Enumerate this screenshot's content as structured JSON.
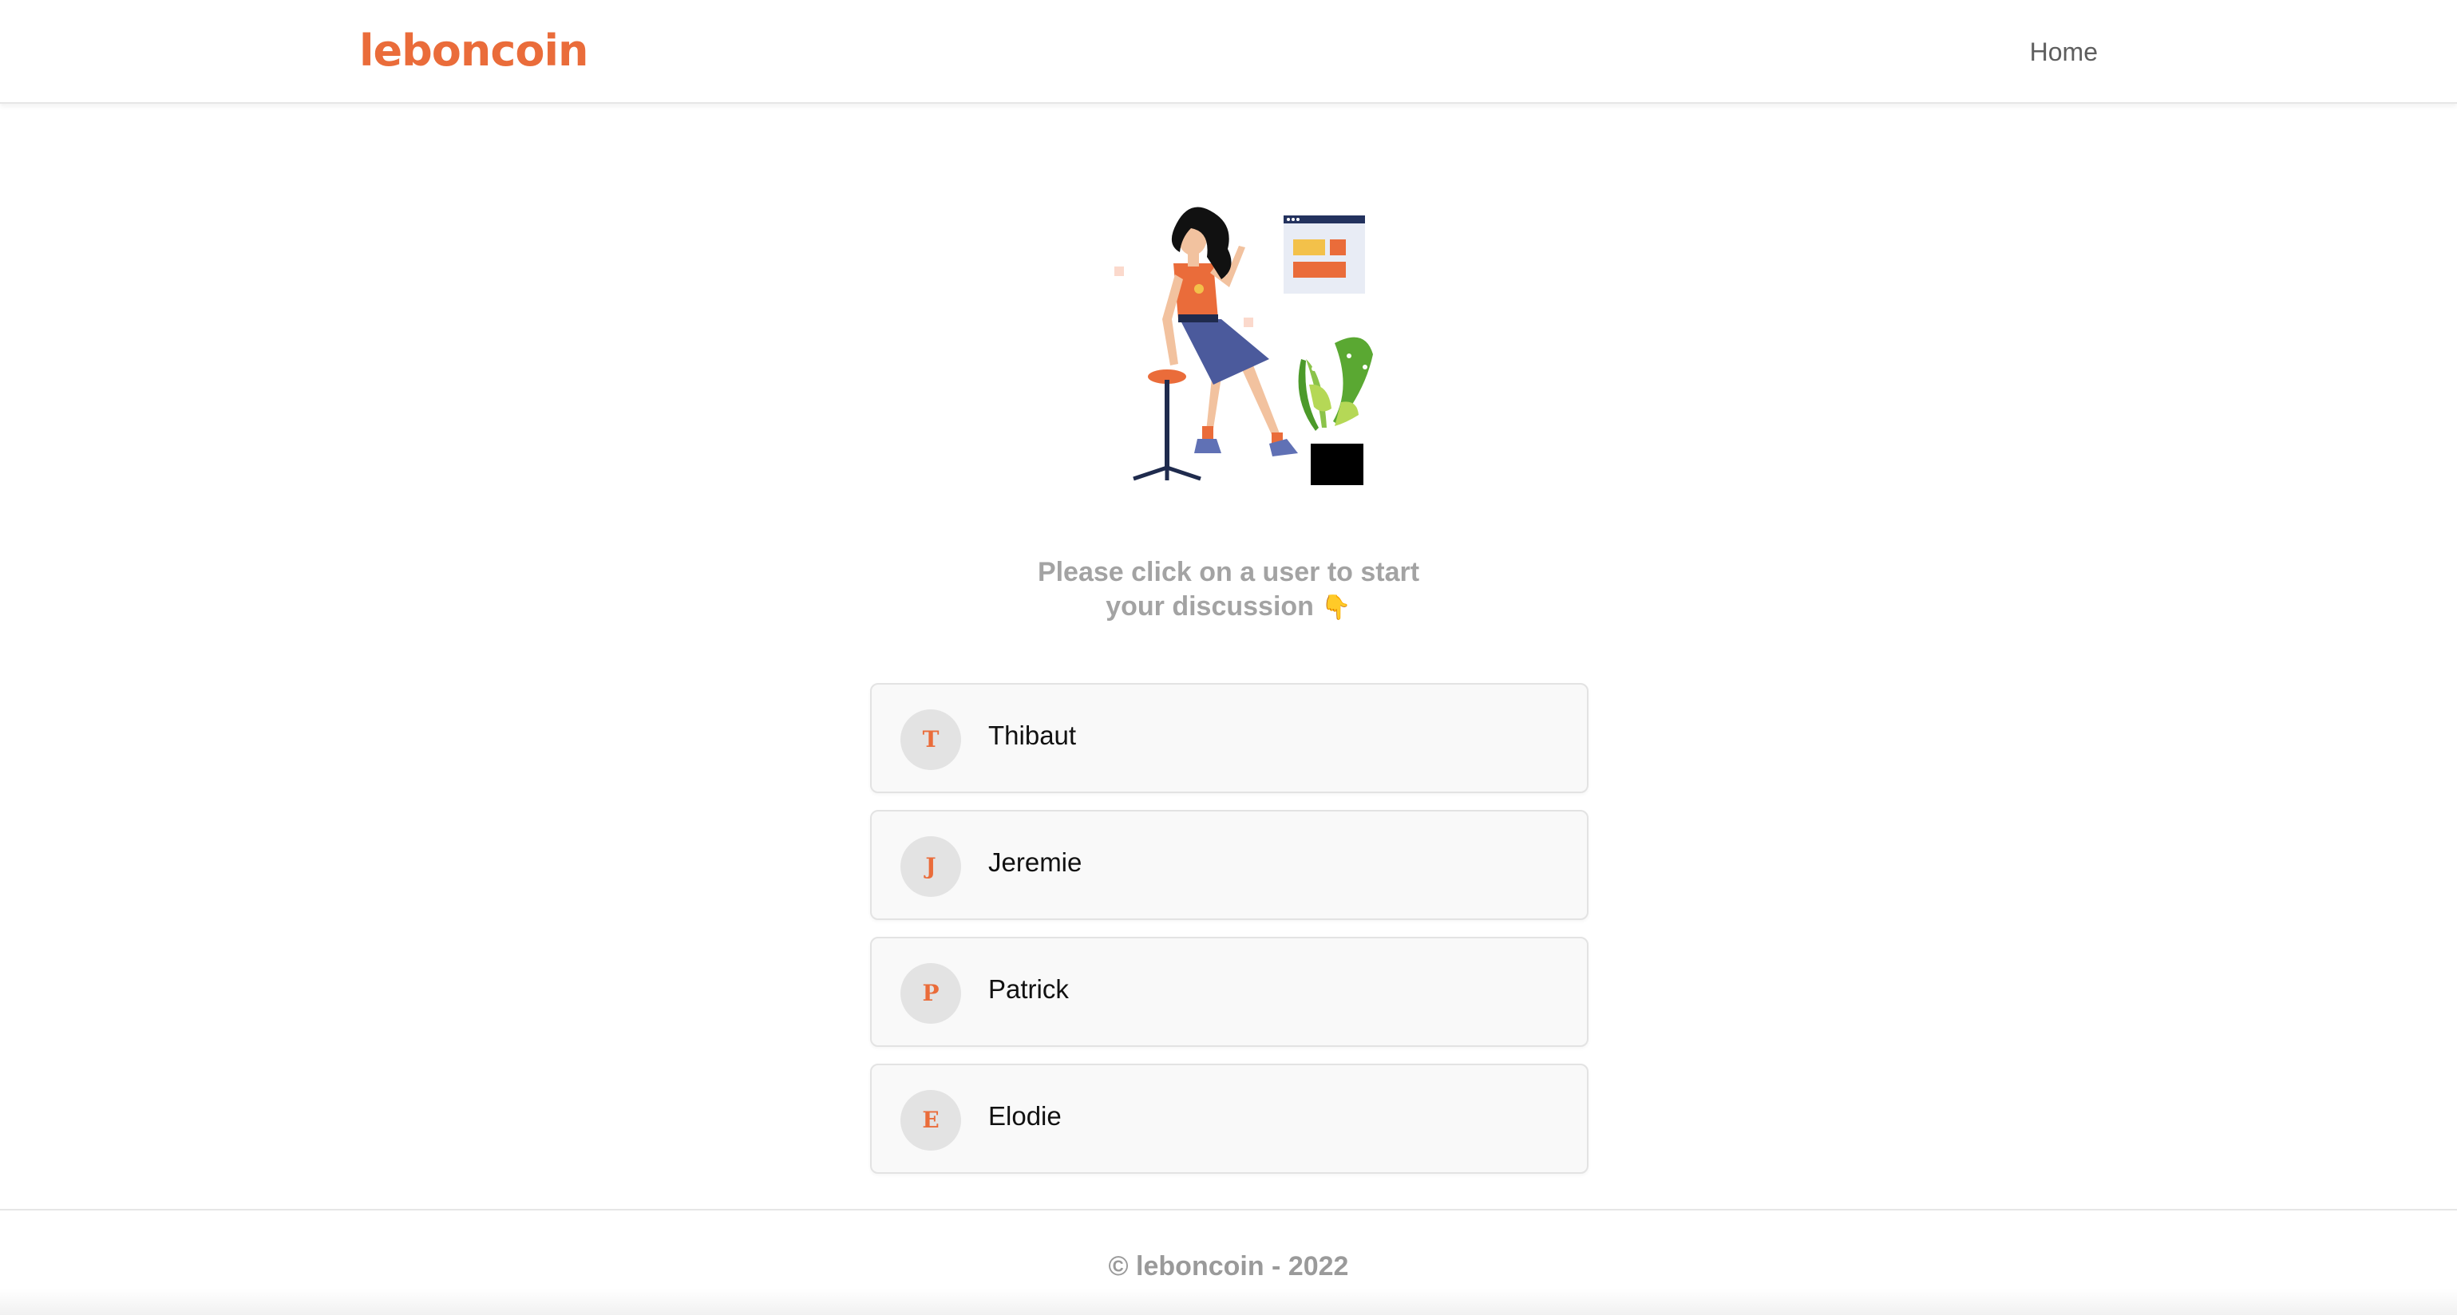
{
  "header": {
    "logo_text": "leboncoin",
    "nav_home_label": "Home"
  },
  "main": {
    "illustration_icon": "woman-on-stool-illustration",
    "prompt_line1": "Please click on a user to start",
    "prompt_line2": "your discussion",
    "prompt_emoji": "👇",
    "users": [
      {
        "initial": "T",
        "name": "Thibaut"
      },
      {
        "initial": "J",
        "name": "Jeremie"
      },
      {
        "initial": "P",
        "name": "Patrick"
      },
      {
        "initial": "E",
        "name": "Elodie"
      }
    ]
  },
  "footer": {
    "copyright_text": "© leboncoin - 2022"
  },
  "colors": {
    "brand_orange": "#ea6c3a",
    "muted_text": "#a3a3a3",
    "card_background": "#f9f9f9"
  }
}
